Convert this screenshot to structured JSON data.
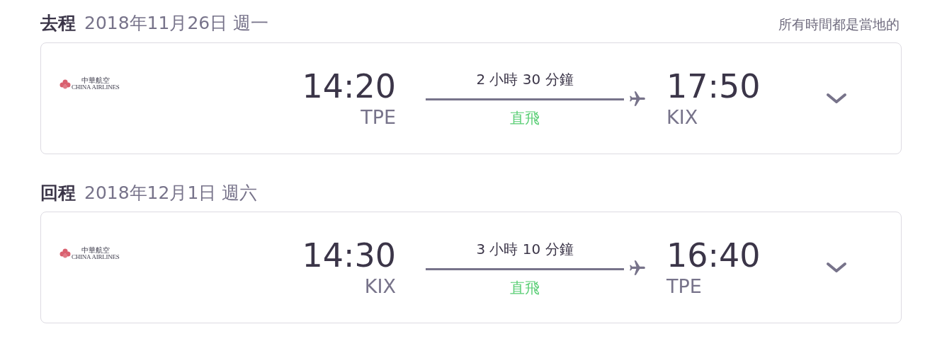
{
  "note": "所有時間都是當地的",
  "legs": [
    {
      "label": "去程",
      "date": "2018年11月26日 週一",
      "airline_cn": "中華航空",
      "airline_en": "CHINA AIRLINES",
      "dep_time": "14:20",
      "dep_code": "TPE",
      "duration": "2 小時 30 分鐘",
      "stops": "直飛",
      "arr_time": "17:50",
      "arr_code": "KIX",
      "expanded": false
    },
    {
      "label": "回程",
      "date": "2018年12月1日 週六",
      "airline_cn": "中華航空",
      "airline_en": "CHINA AIRLINES",
      "dep_time": "14:30",
      "dep_code": "KIX",
      "duration": "3 小時 10 分鐘",
      "stops": "直飛",
      "arr_time": "16:40",
      "arr_code": "TPE",
      "expanded": false
    }
  ]
}
